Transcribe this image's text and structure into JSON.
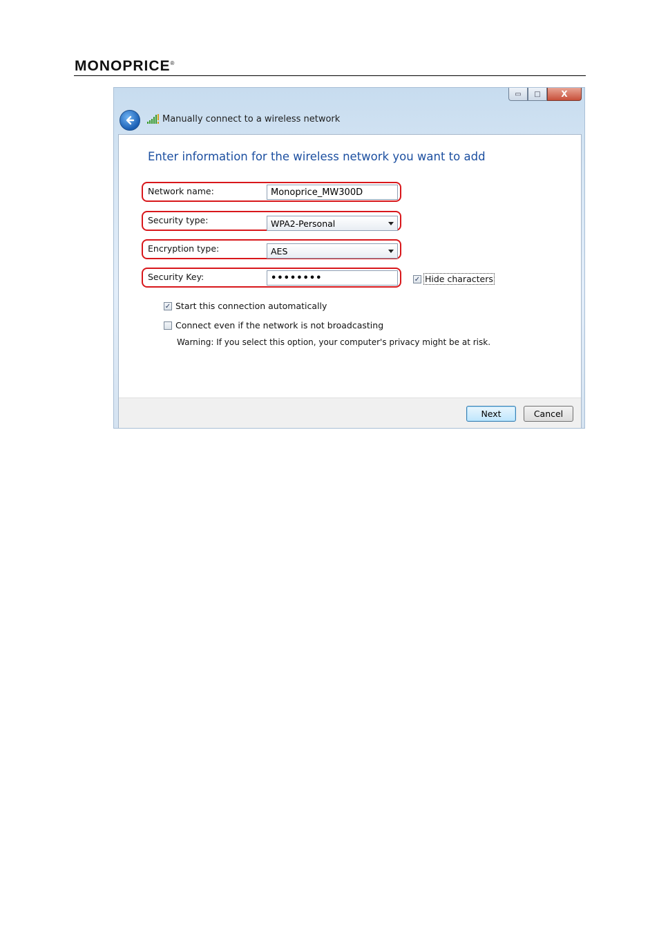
{
  "header": {
    "logo_text": "MONOPRICE",
    "logo_mark": "®"
  },
  "window": {
    "title": "Manually connect to a wireless network",
    "controls": {
      "minimize": "▭",
      "maximize": "□",
      "close": "X"
    },
    "back_icon": "back-arrow-icon",
    "signal_icon": "wireless-signal-icon"
  },
  "form": {
    "heading": "Enter information for the wireless network you want to add",
    "network_name": {
      "label": "Network name:",
      "value": "Monoprice_MW300D"
    },
    "security_type": {
      "label": "Security type:",
      "value": "WPA2-Personal"
    },
    "encryption_type": {
      "label": "Encryption type:",
      "value": "AES"
    },
    "security_key": {
      "label": "Security Key:",
      "value": "••••••••"
    },
    "hide_characters": {
      "label": "Hide characters",
      "checked": true
    },
    "start_automatically": {
      "label": "Start this connection automatically",
      "checked": true
    },
    "connect_not_broadcasting": {
      "label": "Connect even if the network is not broadcasting",
      "checked": false
    },
    "warning": "Warning: If you select this option, your computer's privacy might be at risk."
  },
  "buttons": {
    "next": "Next",
    "cancel": "Cancel"
  },
  "colors": {
    "highlight": "#d8171b",
    "heading": "#1c4fa0"
  }
}
